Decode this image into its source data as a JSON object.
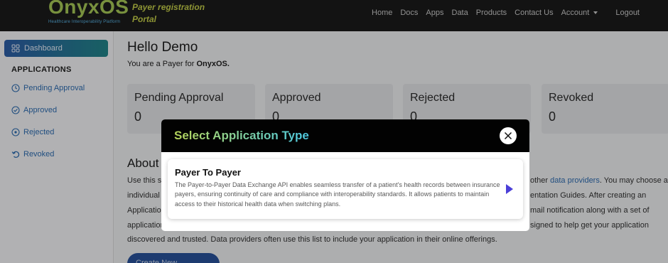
{
  "header": {
    "logo": "OnyxOS",
    "logo_subtitle": "Healthcare Interoperability Platform",
    "portal_line1": "Payer registration",
    "portal_line2": "Portal",
    "nav": [
      "Home",
      "Docs",
      "Apps",
      "Data",
      "Products",
      "Contact Us"
    ],
    "account": "Account",
    "logout": "Logout"
  },
  "sidebar": {
    "dashboard": "Dashboard",
    "section": "APPLICATIONS",
    "items": [
      {
        "label": "Pending Approval",
        "icon": "clock-icon"
      },
      {
        "label": "Approved",
        "icon": "check-circle-icon"
      },
      {
        "label": "Rejected",
        "icon": "x-circle-icon"
      },
      {
        "label": "Revoked",
        "icon": "undo-icon"
      }
    ]
  },
  "main": {
    "greeting": "Hello Demo",
    "role_prefix": "You are a Payer for",
    "role_org": "OnyxOS.",
    "cards": [
      {
        "title": "Pending Approval",
        "value": "0"
      },
      {
        "title": "Approved",
        "value": "0"
      },
      {
        "title": "Rejected",
        "value": "0"
      },
      {
        "title": "Revoked",
        "value": "0"
      }
    ],
    "about_heading": "About",
    "about_lines": [
      "Use this si",
      "individual l",
      "Applicatio",
      "application"
    ],
    "about_right_lines": [
      "other",
      "data providers",
      ". You may choose an",
      "entation Guides. After creating an",
      "mail notification along with a set of",
      "signed to help get your application"
    ],
    "about_full_line": "discovered and trusted. Data providers often use this list to include your application in their online offerings.",
    "create_button": "Create New Application"
  },
  "modal": {
    "title": "Select Application Type",
    "option_title": "Payer To Payer",
    "option_desc": "The Payer-to-Payer Data Exchange API enables seamless transfer of a patient's health records between insurance payers, ensuring continuity of care and compliance with interoperability standards. It allows patients to maintain access to their historical health data when switching plans."
  }
}
